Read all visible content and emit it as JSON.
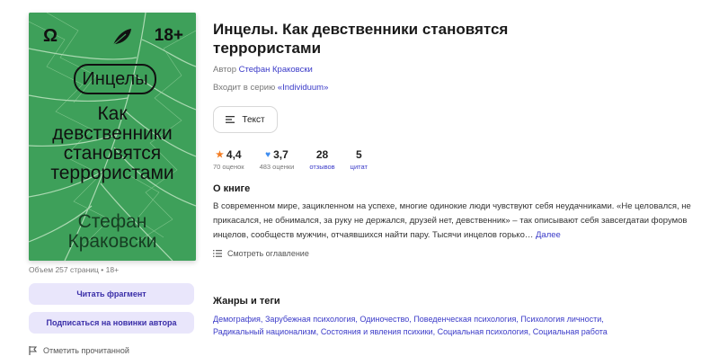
{
  "cover": {
    "publisher_mark": "Ω",
    "age_badge": "18+",
    "series_pill": "Инцелы",
    "subtitle_lines": [
      "Как",
      "девственники",
      "становятся",
      "террористами"
    ],
    "author_lines": [
      "Стефан",
      "Краковски"
    ],
    "colors": {
      "background": "#3ea05a",
      "text": "#111111"
    }
  },
  "book_meta": {
    "pages_label": "Объем 257 страниц",
    "separator": "•",
    "age": "18+"
  },
  "buttons": {
    "read_fragment": "Читать фрагмент",
    "subscribe_author": "Подписаться на новинки автора",
    "mark_read": "Отметить прочитанной"
  },
  "book": {
    "title_line1": "Инцелы. Как девственники становятся",
    "title_line2": "террористами",
    "author_prefix": "Автор",
    "author_name": "Стефан Краковски",
    "series_prefix": "Входит в серию",
    "series_name": "«Individuum»",
    "format_label": "Текст"
  },
  "stats": {
    "rating": {
      "value": "4,4",
      "sub": "70 оценок"
    },
    "likes": {
      "value": "3,7",
      "sub": "483 оценки"
    },
    "reviews": {
      "value": "28",
      "sub": "отзывов"
    },
    "quotes": {
      "value": "5",
      "sub": "цитат"
    }
  },
  "about": {
    "heading": "О книге",
    "text": "В современном мире, зацикленном на успехе, многие одинокие люди чувствуют себя неудачниками. «Не целовался, не прикасался, не обнимался, за руку не держался, друзей нет, девственник» – так описывают себя завсегдатаи форумов инцелов, сообществ мужчин, отчаявшихся найти пару. Тысячи инцелов горько…",
    "more": "Далее",
    "toc_label": "Смотреть оглавление"
  },
  "genres": {
    "heading": "Жанры и теги",
    "tags": [
      "Демография",
      "Зарубежная психология",
      "Одиночество",
      "Поведенческая психология",
      "Психология личности",
      "Радикальный национализм",
      "Состояния и явления психики",
      "Социальная психология",
      "Социальная работа"
    ]
  },
  "accent_color": "#3a3ac8"
}
